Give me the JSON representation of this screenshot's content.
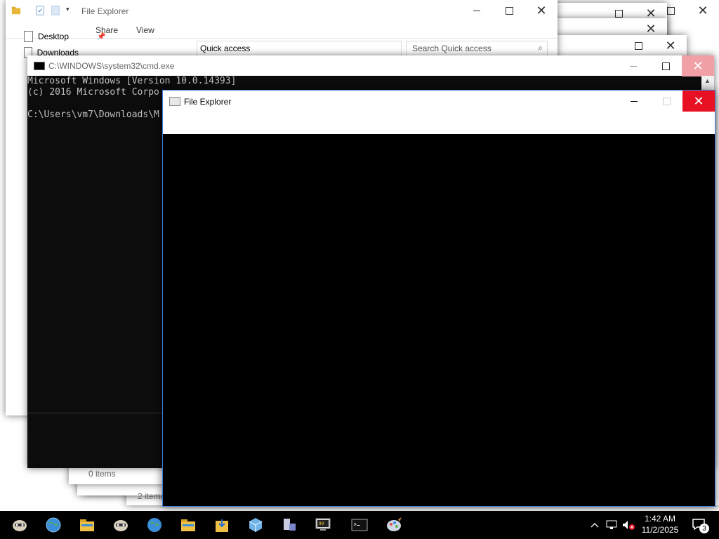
{
  "file_explorer_back": {
    "title": "File Explorer",
    "ribbon_tabs": [
      "Share",
      "View"
    ],
    "address": "Quick access",
    "search_placeholder": "Search Quick access",
    "pinned": [
      "Desktop",
      "Downloads"
    ],
    "status_items_1": "0 items",
    "status_items_2": "2 items"
  },
  "cmd": {
    "title": "C:\\WINDOWS\\system32\\cmd.exe",
    "lines": [
      "Microsoft Windows [Version 10.0.14393]",
      "(c) 2016 Microsoft Corpo",
      "",
      "C:\\Users\\vm7\\Downloads\\M"
    ]
  },
  "file_explorer_front": {
    "title": "File Explorer"
  },
  "taskbar": {
    "apps": [
      "raccoon-app-icon",
      "globe-icon",
      "folder-icon",
      "raccoon-app-icon",
      "globe-icon",
      "folder-icon",
      "downloads-folder-icon",
      "cube-icon",
      "network-pc-icon",
      "monitor-app-icon",
      "terminal-icon",
      "paint-icon"
    ],
    "time": "1:42 AM",
    "date": "11/2/2025",
    "notification_count": "3"
  },
  "colors": {
    "close_red": "#e81123",
    "taskbar_bg": "#000000",
    "accent_blue": "#3c7ddc"
  }
}
